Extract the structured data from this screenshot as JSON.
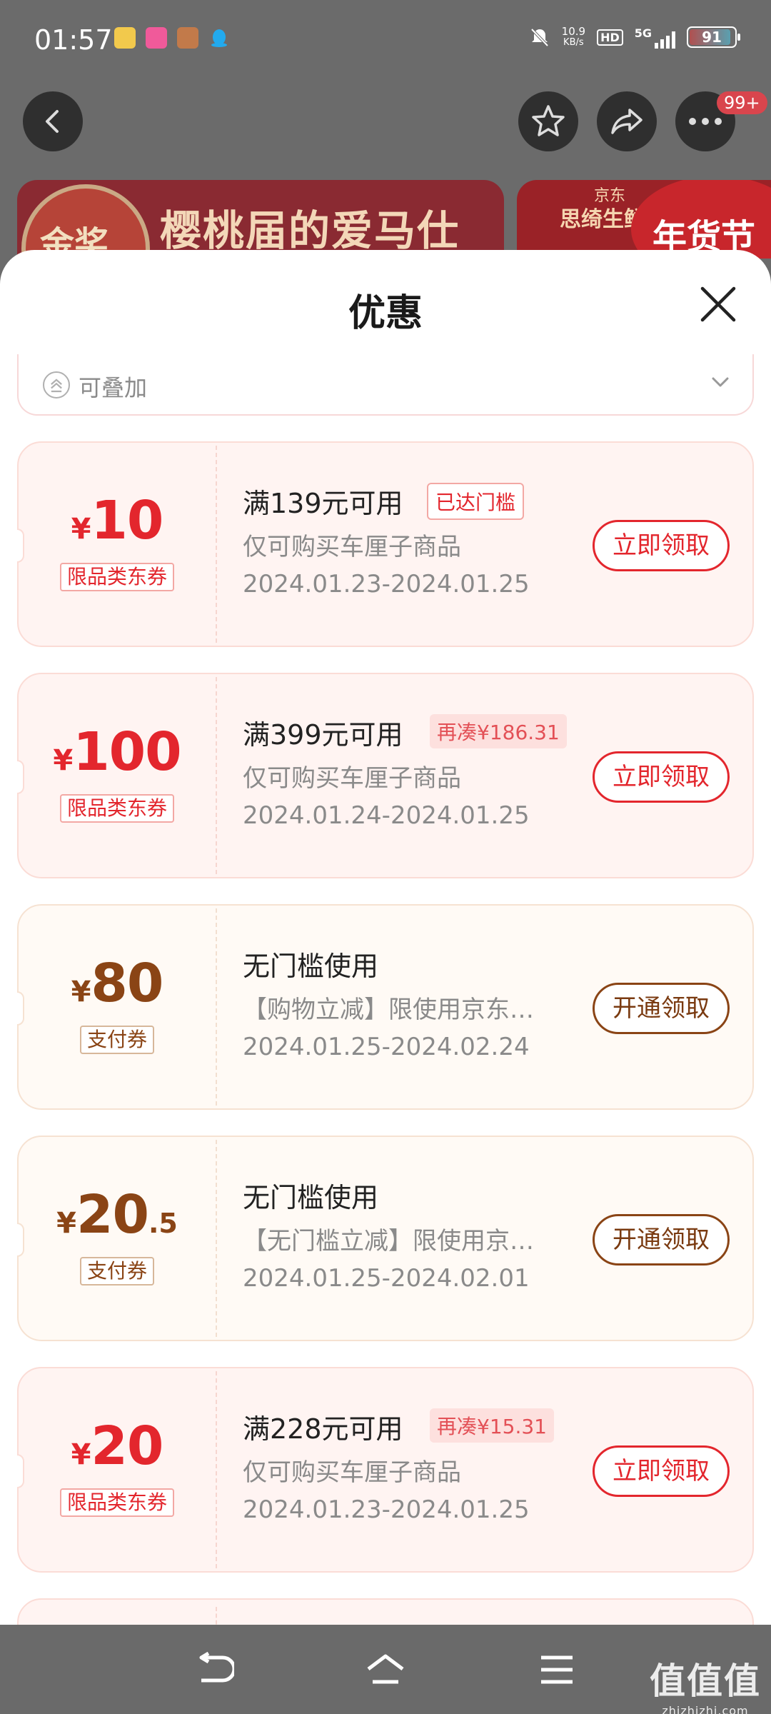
{
  "status_bar": {
    "time": "01:57",
    "net_speed_value": "10.9",
    "net_speed_unit": "KB/s",
    "hd": "HD",
    "network": "5G",
    "battery": "91",
    "icons": [
      "app-icon-1",
      "app-icon-2",
      "app-icon-3",
      "qq-icon",
      "mute-bell-icon",
      "signal-icon",
      "battery-icon"
    ]
  },
  "top_actions": {
    "back": "back-icon",
    "favorite": "star-icon",
    "share": "share-icon",
    "more": "more-icon",
    "more_badge": "99+"
  },
  "banners": {
    "banner1_medal": "金奖",
    "banner1_title": "樱桃届的爱马仕",
    "banner2_brand": "京东",
    "banner2_title": "思绮生鲜",
    "banner2_festival": "年货节"
  },
  "sheet": {
    "title": "优惠",
    "filter_label": "可叠加"
  },
  "coupons": [
    {
      "currency": "¥",
      "amount": "10",
      "decimal": "",
      "tag": "限品类东券",
      "title": "满139元可用",
      "chip": "已达门槛",
      "desc": "仅可购买车厘子商品",
      "date": "2024.01.23-2024.01.25",
      "button": "立即领取"
    },
    {
      "currency": "¥",
      "amount": "100",
      "decimal": "",
      "tag": "限品类东券",
      "title": "满399元可用",
      "chip": "再凑¥186.31",
      "desc": "仅可购买车厘子商品",
      "date": "2024.01.24-2024.01.25",
      "button": "立即领取"
    },
    {
      "currency": "¥",
      "amount": "80",
      "decimal": "",
      "tag": "支付券",
      "title": "无门槛使用",
      "chip": "",
      "desc": "【购物立减】限使用京东…",
      "date": "2024.01.25-2024.02.24",
      "button": "开通领取"
    },
    {
      "currency": "¥",
      "amount": "20",
      "decimal": ".5",
      "tag": "支付券",
      "title": "无门槛使用",
      "chip": "",
      "desc": "【无门槛立减】限使用京…",
      "date": "2024.01.25-2024.02.01",
      "button": "开通领取"
    },
    {
      "currency": "¥",
      "amount": "20",
      "decimal": "",
      "tag": "限品类东券",
      "title": "满228元可用",
      "chip": "再凑¥15.31",
      "desc": "仅可购买车厘子商品",
      "date": "2024.01.23-2024.01.25",
      "button": "立即领取"
    }
  ],
  "nav": {
    "back": "nav-back-icon",
    "home": "nav-home-icon",
    "menu": "nav-menu-icon"
  },
  "watermark": {
    "big": "值值值",
    "small": "zhizhizhi.com"
  },
  "colors": {
    "accent_red": "#e3262d",
    "accent_brown": "#8a4415",
    "overlay": "#6b6b6b"
  }
}
